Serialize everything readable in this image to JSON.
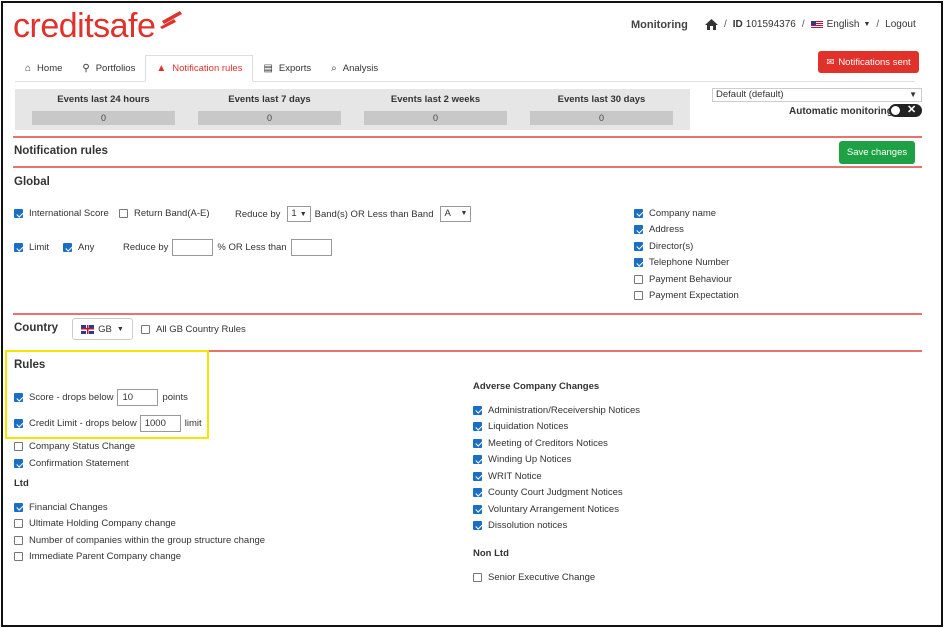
{
  "brand": {
    "logo_text": "creditsafe",
    "color": "#e0312b"
  },
  "topnav": {
    "monitoring": "Monitoring",
    "id_label": "ID",
    "id_value": "101594376",
    "language": "English",
    "logout": "Logout"
  },
  "tabs": [
    {
      "label": "Home",
      "icon": "home-icon"
    },
    {
      "label": "Portfolios",
      "icon": "portfolio-icon"
    },
    {
      "label": "Notification rules",
      "icon": "warning-icon",
      "active": true
    },
    {
      "label": "Exports",
      "icon": "document-icon"
    },
    {
      "label": "Analysis",
      "icon": "search-icon"
    }
  ],
  "notifications_button": "Notifications sent",
  "events": [
    {
      "label": "Events last 24 hours",
      "value": "0"
    },
    {
      "label": "Events last 7 days",
      "value": "0"
    },
    {
      "label": "Events last 2 weeks",
      "value": "0"
    },
    {
      "label": "Events last 30 days",
      "value": "0"
    }
  ],
  "default_select": "Default (default)",
  "auto_monitoring": "Automatic monitoring",
  "notification_rules_title": "Notification rules",
  "save_button": "Save changes",
  "global": {
    "title": "Global",
    "international_score": "International Score",
    "return_band": "Return Band(A-E)",
    "reduce_by": "Reduce by",
    "reduce_by_value": "1",
    "bands_or_less": "Band(s) OR Less than Band",
    "band_value": "A",
    "limit": "Limit",
    "any": "Any",
    "reduce_by_2": "Reduce by",
    "pct_or_less": "% OR Less than",
    "right_checks": [
      {
        "label": "Company name",
        "checked": true
      },
      {
        "label": "Address",
        "checked": true
      },
      {
        "label": "Director(s)",
        "checked": true
      },
      {
        "label": "Telephone Number",
        "checked": true
      },
      {
        "label": "Payment Behaviour",
        "checked": false
      },
      {
        "label": "Payment Expectation",
        "checked": false
      }
    ]
  },
  "country": {
    "title": "Country",
    "selected": "GB",
    "all_rules": "All GB Country Rules"
  },
  "rules": {
    "title": "Rules",
    "score_label": "Score - drops below",
    "score_value": "10",
    "score_unit": "points",
    "credit_label": "Credit Limit - drops below",
    "credit_value": "1000",
    "credit_unit": "limit",
    "company_status": "Company Status Change",
    "confirmation": "Confirmation Statement",
    "ltd_title": "Ltd",
    "ltd_items": [
      {
        "label": "Financial Changes",
        "checked": true
      },
      {
        "label": "Ultimate Holding Company change",
        "checked": false
      },
      {
        "label": "Number of companies within the group structure change",
        "checked": false
      },
      {
        "label": "Immediate Parent Company change",
        "checked": false
      }
    ],
    "adverse_title": "Adverse Company Changes",
    "adverse_items": [
      {
        "label": "Administration/Receivership Notices",
        "checked": true
      },
      {
        "label": "Liquidation Notices",
        "checked": true
      },
      {
        "label": "Meeting of Creditors Notices",
        "checked": true
      },
      {
        "label": "Winding Up Notices",
        "checked": true
      },
      {
        "label": "WRIT Notice",
        "checked": true
      },
      {
        "label": "County Court Judgment Notices",
        "checked": true
      },
      {
        "label": "Voluntary Arrangement Notices",
        "checked": true
      },
      {
        "label": "Dissolution notices",
        "checked": true
      }
    ],
    "nonltd_title": "Non Ltd",
    "nonltd_items": [
      {
        "label": "Senior Executive Change",
        "checked": false
      }
    ]
  },
  "colors": {
    "highlight": "#f3e600",
    "save": "#1ea144",
    "checkbox": "#1a6fc4"
  }
}
